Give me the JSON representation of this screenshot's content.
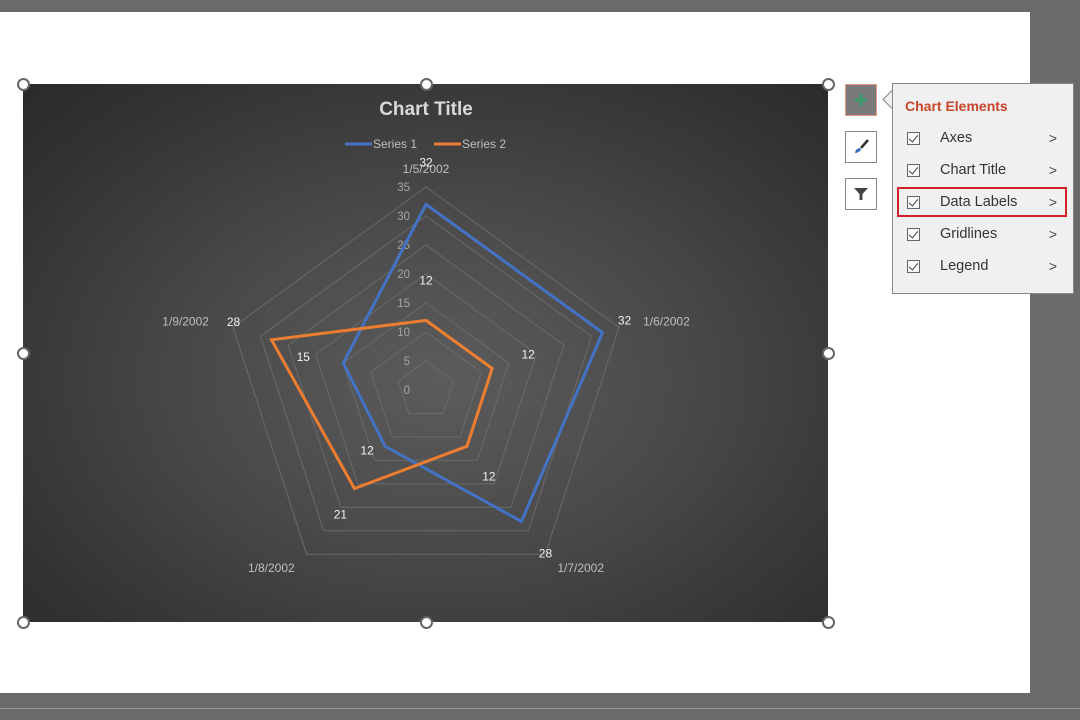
{
  "chart_data": {
    "type": "radar",
    "title": "Chart Title",
    "categories": [
      "1/5/2002",
      "1/6/2002",
      "1/7/2002",
      "1/8/2002",
      "1/9/2002"
    ],
    "series": [
      {
        "name": "Series 1",
        "color": "#4472c4",
        "values": [
          32,
          32,
          28,
          12,
          15
        ]
      },
      {
        "name": "Series 2",
        "color": "#ed7d31",
        "values": [
          12,
          12,
          12,
          21,
          28
        ]
      }
    ],
    "axis": {
      "min": 0,
      "max": 35,
      "major_unit": 5,
      "tick_labels": [
        "0",
        "5",
        "10",
        "15",
        "20",
        "25",
        "30",
        "35"
      ]
    },
    "gridlines": true,
    "data_labels": true,
    "legend_position": "top"
  },
  "panel": {
    "title": "Chart Elements",
    "items": [
      {
        "label": "Axes",
        "checked": true
      },
      {
        "label": "Chart Title",
        "checked": true
      },
      {
        "label": "Data Labels",
        "checked": true
      },
      {
        "label": "Gridlines",
        "checked": true
      },
      {
        "label": "Legend",
        "checked": true
      }
    ]
  },
  "side_buttons": [
    {
      "name": "chart-elements",
      "icon": "plus-icon"
    },
    {
      "name": "chart-styles",
      "icon": "brush-icon"
    },
    {
      "name": "chart-filters",
      "icon": "filter-icon"
    }
  ],
  "colors": {
    "accent": "#c8452a",
    "highlight_box": "#d0202a",
    "plus": "#2e8b57"
  }
}
